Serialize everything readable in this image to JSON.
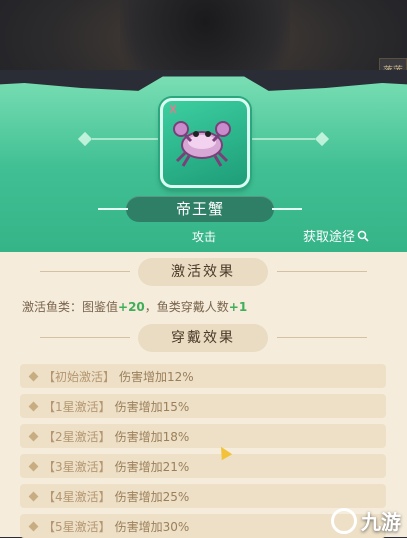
{
  "background": {
    "sign_text": "落莲"
  },
  "item": {
    "name": "帝王蟹",
    "type": "攻击",
    "source_link": "获取途径",
    "icon": "crab-icon",
    "badge": "x"
  },
  "activation": {
    "title": "激活效果",
    "stat_prefix": "激活鱼类：图鉴值",
    "stat_value_1": "+20",
    "stat_mid": "，鱼类穿戴人数",
    "stat_value_2": "+1"
  },
  "wear": {
    "title": "穿戴效果",
    "rows": [
      {
        "tag": "【初始激活】",
        "desc": "伤害增加12%"
      },
      {
        "tag": "【1星激活】",
        "desc": "伤害增加15%"
      },
      {
        "tag": "【2星激活】",
        "desc": "伤害增加18%"
      },
      {
        "tag": "【3星激活】",
        "desc": "伤害增加21%"
      },
      {
        "tag": "【4星激活】",
        "desc": "伤害增加25%"
      },
      {
        "tag": "【5星激活】",
        "desc": "伤害增加30%"
      }
    ]
  },
  "watermark": {
    "text": "九游"
  },
  "colors": {
    "header_green": "#3fbf93",
    "body_cream": "#f5ecdb",
    "plus_green": "#3fae5a",
    "name_plate": "#2f7f66"
  }
}
